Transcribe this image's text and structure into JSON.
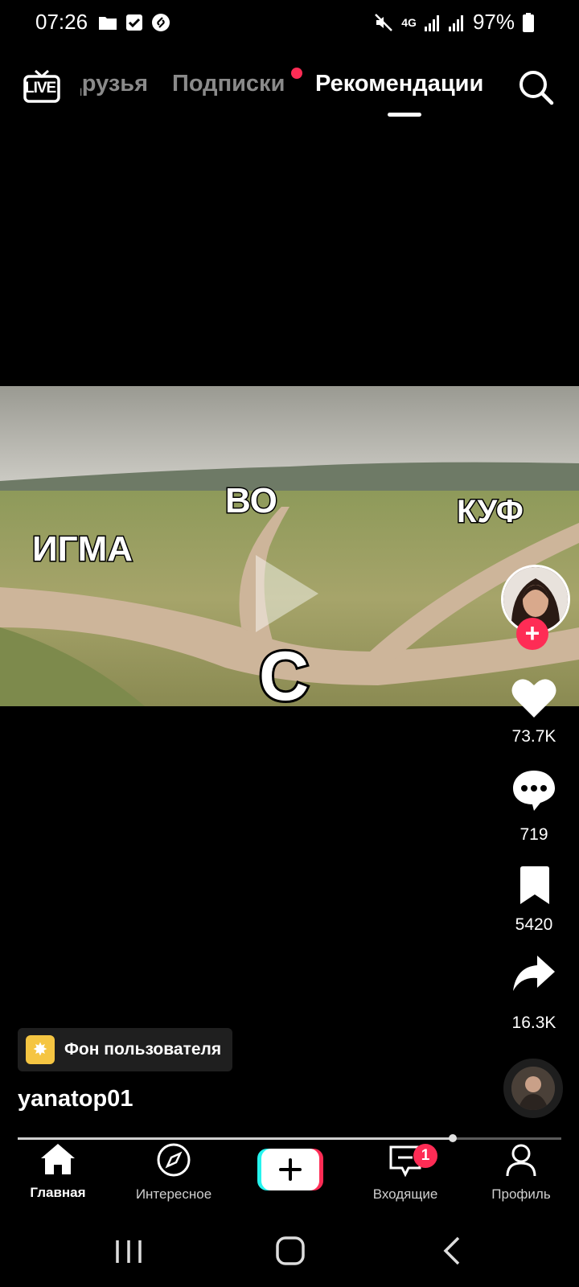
{
  "status_bar": {
    "time": "07:26",
    "network": "4G",
    "battery": "97%",
    "left_icons": [
      "folder-icon",
      "checkbox-icon",
      "shazam-icon"
    ],
    "right_icons": [
      "mute-icon",
      "network-4g-icon",
      "signal-icon",
      "signal-icon",
      "battery-icon"
    ]
  },
  "top_nav": {
    "live_label": "LIVE",
    "tabs": [
      {
        "label": "Друзья"
      },
      {
        "label": "Подписки"
      },
      {
        "label": "Рекомендации"
      }
    ],
    "subs_notification_color": "#fe2c55"
  },
  "video": {
    "overlay_words": [
      "ВО",
      "КУФ",
      "ИГМА",
      "С"
    ]
  },
  "right_rail": {
    "likes": "73.7K",
    "comments": "719",
    "saves": "5420",
    "shares": "16.3K",
    "follow_symbol": "+"
  },
  "caption": {
    "chip_label": "Фон пользователя",
    "username": "yanatop01"
  },
  "progress": {
    "fraction": 0.8
  },
  "bottom_nav": {
    "items": [
      {
        "label": "Главная",
        "icon": "home-icon"
      },
      {
        "label": "Интересное",
        "icon": "compass-icon"
      },
      {
        "label": "",
        "icon": "plus-icon"
      },
      {
        "label": "Входящие",
        "icon": "inbox-icon",
        "badge": "1"
      },
      {
        "label": "Профиль",
        "icon": "person-icon"
      }
    ]
  },
  "system_nav": [
    "recents-icon",
    "home-circle-icon",
    "back-icon"
  ],
  "colors": {
    "accent": "#fe2c55",
    "background": "#000000"
  }
}
